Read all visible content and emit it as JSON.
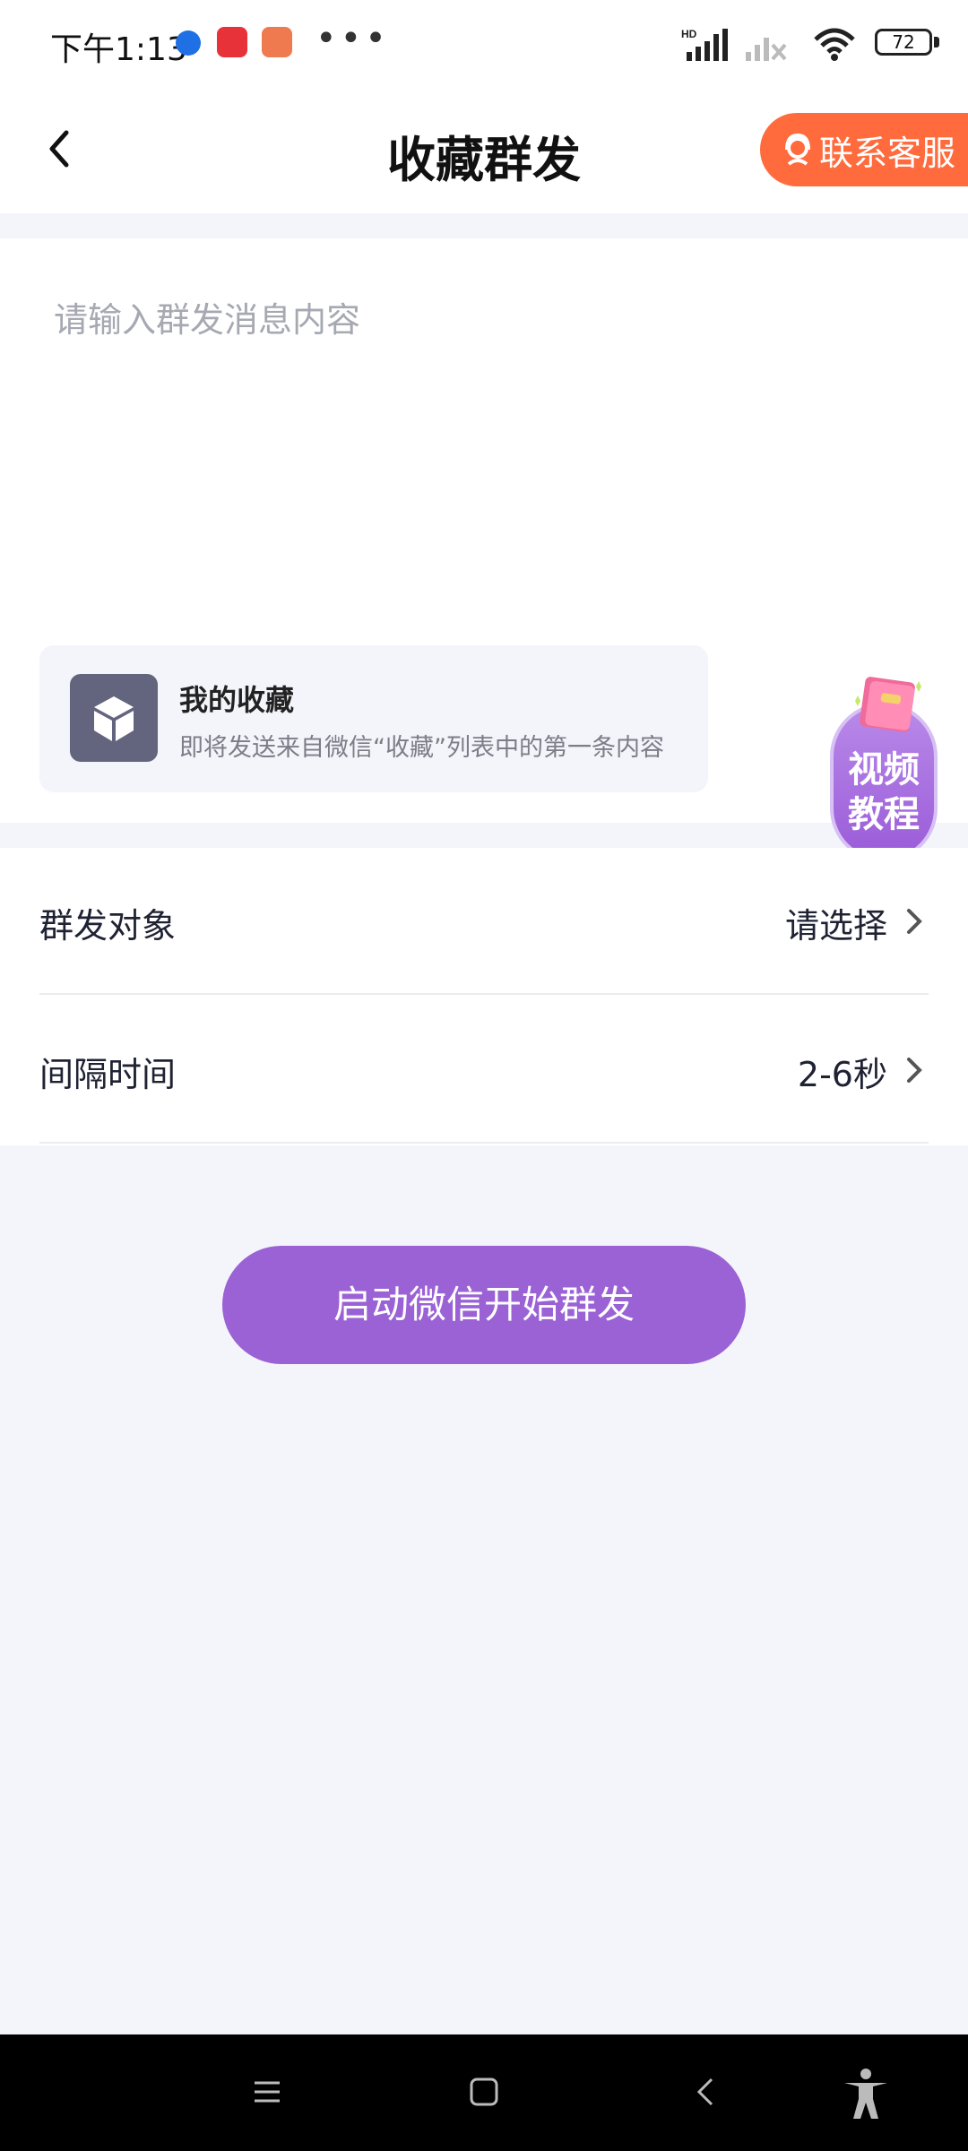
{
  "status_bar": {
    "time": "下午1:13",
    "battery": "72",
    "network_label": "HD"
  },
  "header": {
    "title": "收藏群发",
    "support_label": "联系客服"
  },
  "message": {
    "placeholder": "请输入群发消息内容"
  },
  "favorite": {
    "title": "我的收藏",
    "description": "即将发送来自微信“收藏”列表中的第一条内容"
  },
  "settings": [
    {
      "label": "群发对象",
      "value": "请选择"
    },
    {
      "label": "间隔时间",
      "value": "2-6秒"
    }
  ],
  "video_tutorial": {
    "line1": "视频",
    "line2": "教程"
  },
  "start_button": {
    "label": "启动微信开始群发"
  },
  "colors": {
    "accent": "#9b62d5",
    "support": "#ff6b3d",
    "background": "#f4f5fa"
  }
}
